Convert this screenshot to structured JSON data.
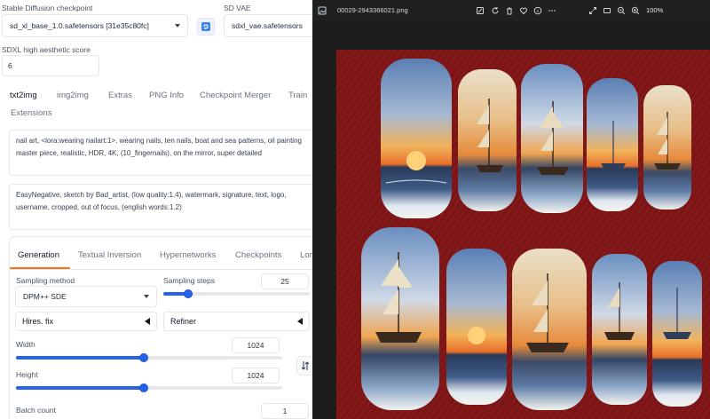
{
  "checkpoint": {
    "label": "Stable Diffusion checkpoint",
    "value": "sd_xl_base_1.0.safetensors [31e35c80fc]"
  },
  "vae": {
    "label": "SD VAE",
    "value": "sdxl_vae.safetensors"
  },
  "aesthetic": {
    "label": "SDXL high aesthetic score",
    "value": "6"
  },
  "main_tabs": [
    "txt2img",
    "img2img",
    "Extras",
    "PNG Info",
    "Checkpoint Merger",
    "Train",
    "Extensions"
  ],
  "prompt": {
    "positive": "nail art, <lora:wearing nailart:1>, wearing nails, ten nails, boat and sea patterns, oil painting master piece, realistic, HDR, 4K, (10_fingernails), on the mirror, super detailed",
    "negative": "EasyNegative, sketch by Bad_artist, (low quality:1.4), watermark, signature, text, logo, username, cropped, out of focus, (english words:1.2)"
  },
  "sub_tabs": [
    "Generation",
    "Textual Inversion",
    "Hypernetworks",
    "Checkpoints",
    "Lora"
  ],
  "generation": {
    "sampling_method_label": "Sampling method",
    "sampling_method_value": "DPM++ SDE",
    "sampling_steps_label": "Sampling steps",
    "sampling_steps_value": "25",
    "sampling_steps_fraction": 0.17,
    "hires_label": "Hires. fix",
    "refiner_label": "Refiner",
    "width_label": "Width",
    "width_value": "1024",
    "width_fraction": 0.48,
    "height_label": "Height",
    "height_value": "1024",
    "height_fraction": 0.48,
    "batch_count_label": "Batch count",
    "batch_count_value": "1"
  },
  "viewer": {
    "filename": "00029-2943366021.png",
    "zoom": "100%",
    "icons": [
      "image-icon",
      "edit-icon",
      "rotate-icon",
      "delete-icon",
      "favorite-icon",
      "info-icon",
      "more-icon",
      "expand-icon",
      "fit-icon",
      "zoom-out-icon",
      "zoom-in-icon"
    ]
  },
  "colors": {
    "accent_tab": "#f97316",
    "slider": "#2563eb",
    "viewer_bg": "#1c1c1c",
    "fabric": "#7a1414"
  }
}
